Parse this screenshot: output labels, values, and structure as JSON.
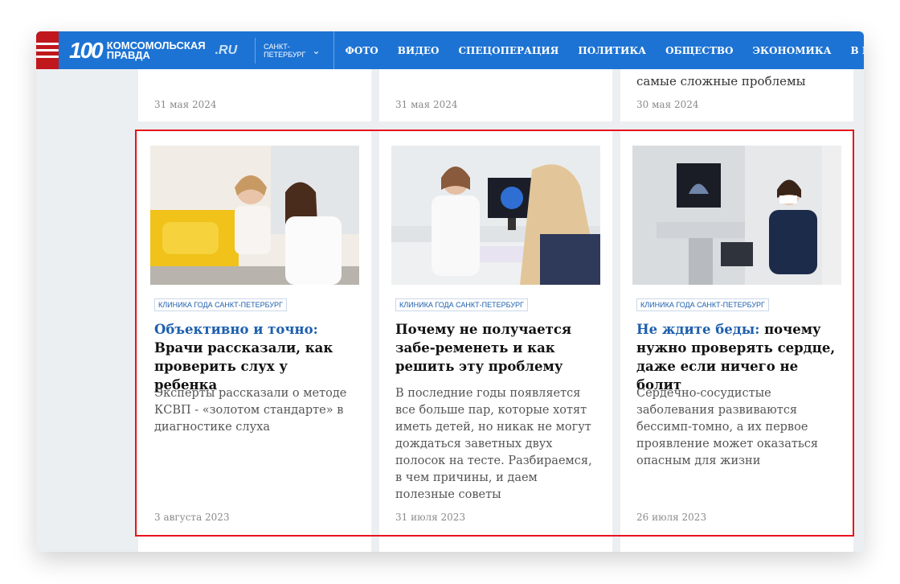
{
  "header": {
    "logo_number": "100",
    "logo_line1": "Комсомольская",
    "logo_line2": "правда",
    "logo_suffix": ".RU",
    "city_line1": "Санкт-",
    "city_line2": "Петербург",
    "nav": [
      "Фото",
      "Видео",
      "Спецоперация",
      "Политика",
      "Общество",
      "Экономика",
      "В ми"
    ]
  },
  "top_row": [
    {
      "fragment": "",
      "date": "31 мая 2024"
    },
    {
      "fragment": "",
      "date": "31 мая 2024"
    },
    {
      "fragment": "самые сложные проблемы",
      "date": "30 мая 2024"
    }
  ],
  "cards": [
    {
      "tag": "Клиника года Санкт-Петербург",
      "title_highlight": "Объективно и точно:",
      "title_rest": " Врачи рассказали, как проверить слух у ребенка",
      "description": "Эксперты рассказали о методе КСВП - «золотом стандарте» в диагностике слуха",
      "date": "3 августа 2023"
    },
    {
      "tag": "Клиника года Санкт-Петербург",
      "title_highlight": "",
      "title_rest": "Почему не получается забе-ременеть и как решить эту проблему",
      "description": "В последние годы появляется все больше пар, которые хотят иметь детей, но никак не могут дождаться заветных двух полосок на тесте. Разбираемся, в чем причины, и даем полезные советы",
      "date": "31 июля 2023"
    },
    {
      "tag": "Клиника года Санкт-Петербург",
      "title_highlight": "Не ждите беды:",
      "title_rest": " почему нужно проверять сердце, даже если ничего не болит",
      "description": "Сердечно-сосудистые заболевания развиваются бессимп-томно, а их первое проявление может оказаться опасным для жизни",
      "date": "26 июля 2023"
    }
  ],
  "colors": {
    "header_bg": "#1d73d3",
    "menu_bg": "#c0181c",
    "accent_text": "#1d5fae",
    "highlight_border": "#e8141b"
  }
}
